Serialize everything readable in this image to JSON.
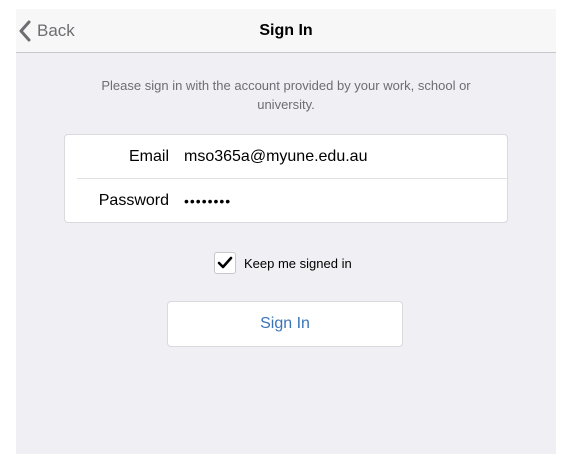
{
  "navbar": {
    "back_label": "Back",
    "title": "Sign In"
  },
  "instructions": "Please sign in with the account provided by your work, school or university.",
  "form": {
    "email_label": "Email",
    "email_value": "mso365a@myune.edu.au",
    "password_label": "Password",
    "password_value": "••••••••"
  },
  "keep_signed_in": {
    "label": "Keep me signed in",
    "checked": true
  },
  "sign_in_button": "Sign In",
  "colors": {
    "background": "#efeff4",
    "accent": "#3a74b8"
  }
}
